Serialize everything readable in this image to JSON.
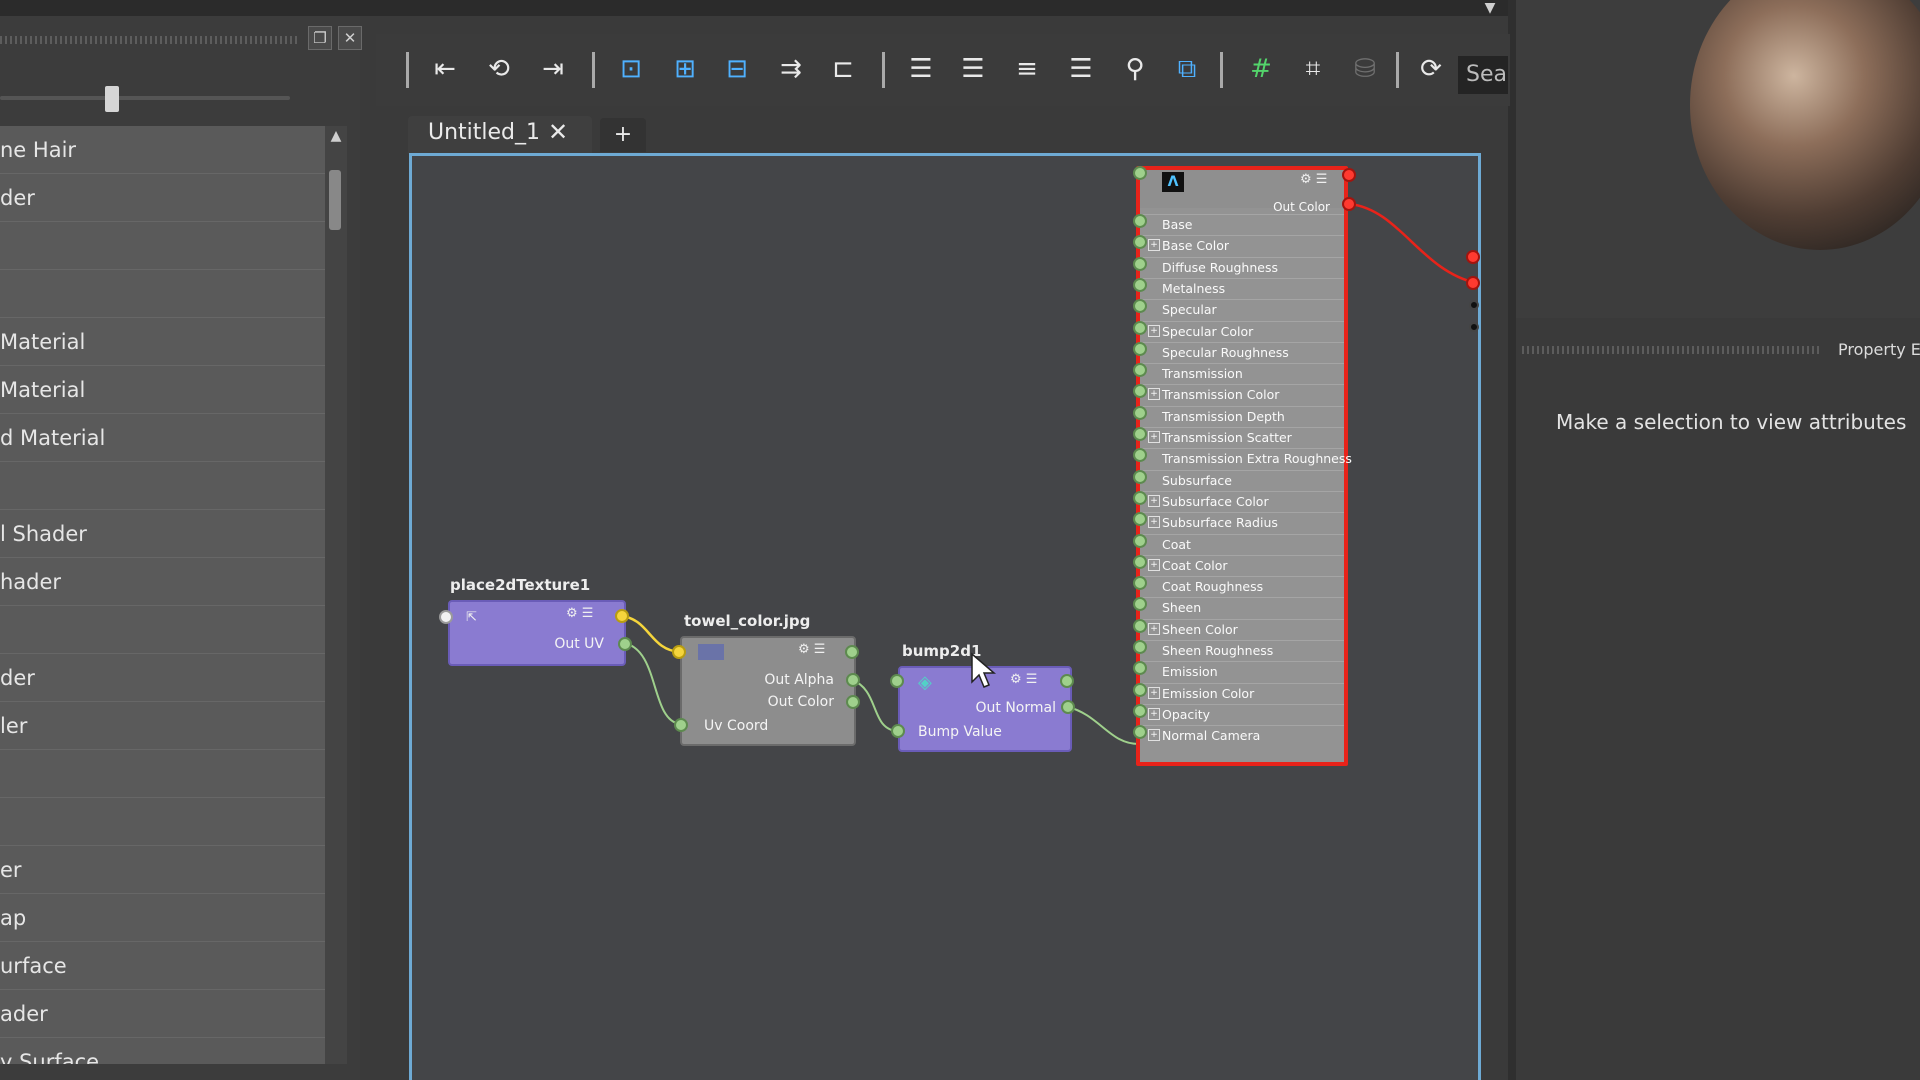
{
  "left_panel": {
    "items": [
      "ne Hair",
      "der",
      "",
      "",
      "Material",
      " Material",
      "d Material",
      "",
      "l Shader",
      "hader",
      "",
      "der",
      "ler",
      "",
      "",
      "er",
      "ap",
      "urface",
      "ader",
      "y Surface"
    ]
  },
  "toolbar": {
    "search_placeholder": "Sea"
  },
  "tabs": [
    {
      "label": "Untitled_1",
      "close": "✕"
    }
  ],
  "tab_add": "+",
  "nodes": {
    "place2d": {
      "name": "place2dTexture1",
      "out_label": "Out UV"
    },
    "file": {
      "name": "towel_color.jpg",
      "out_alpha": "Out Alpha",
      "out_color": "Out Color",
      "in_uv": "Uv Coord"
    },
    "bump": {
      "name": "bump2d1",
      "out_label": "Out Normal",
      "in_label": "Bump Value"
    },
    "shader": {
      "logo": "Λ",
      "out_label": "Out Color",
      "attributes": [
        {
          "label": "Base",
          "exp": false
        },
        {
          "label": "Base Color",
          "exp": true
        },
        {
          "label": "Diffuse Roughness",
          "exp": false
        },
        {
          "label": "Metalness",
          "exp": false
        },
        {
          "label": "Specular",
          "exp": false
        },
        {
          "label": "Specular Color",
          "exp": true
        },
        {
          "label": "Specular Roughness",
          "exp": false
        },
        {
          "label": "Transmission",
          "exp": false
        },
        {
          "label": "Transmission Color",
          "exp": true
        },
        {
          "label": "Transmission Depth",
          "exp": false
        },
        {
          "label": "Transmission Scatter",
          "exp": true
        },
        {
          "label": "Transmission Extra Roughness",
          "exp": false
        },
        {
          "label": "Subsurface",
          "exp": false
        },
        {
          "label": "Subsurface Color",
          "exp": true
        },
        {
          "label": "Subsurface Radius",
          "exp": true
        },
        {
          "label": "Coat",
          "exp": false
        },
        {
          "label": "Coat Color",
          "exp": true
        },
        {
          "label": "Coat Roughness",
          "exp": false
        },
        {
          "label": "Sheen",
          "exp": false
        },
        {
          "label": "Sheen Color",
          "exp": true
        },
        {
          "label": "Sheen Roughness",
          "exp": false
        },
        {
          "label": "Emission",
          "exp": false
        },
        {
          "label": "Emission Color",
          "exp": true
        },
        {
          "label": "Opacity",
          "exp": true
        },
        {
          "label": "Normal Camera",
          "exp": true
        }
      ]
    }
  },
  "property_editor": {
    "title": "Property Ed",
    "message": "Make a selection to view attributes"
  },
  "colors": {
    "selection_border": "#e8231a",
    "canvas_border": "#6eaad4",
    "node_purple": "#8a7bd1"
  }
}
